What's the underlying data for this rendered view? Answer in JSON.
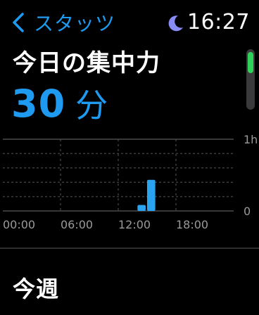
{
  "header": {
    "back_label": "スタッツ",
    "time": "16:27",
    "status_icon": "moon-icon"
  },
  "page_title": "今日の集中力",
  "focus": {
    "value": "30",
    "unit": "分"
  },
  "section_title": "今週",
  "colors": {
    "accent": "#1e9bf0",
    "scroll_thumb": "#2fd158",
    "moon": "#8a8cf5",
    "bar": "#2aa3f0"
  },
  "chart_data": {
    "type": "bar",
    "x_tick_labels": [
      "00:00",
      "06:00",
      "12:00",
      "18:00"
    ],
    "y_tick_labels": [
      "1h",
      "0"
    ],
    "ylim": [
      0,
      60
    ],
    "bins": [
      {
        "start_hour": 14.0,
        "minutes": 5
      },
      {
        "start_hour": 15.0,
        "minutes": 26
      }
    ]
  }
}
